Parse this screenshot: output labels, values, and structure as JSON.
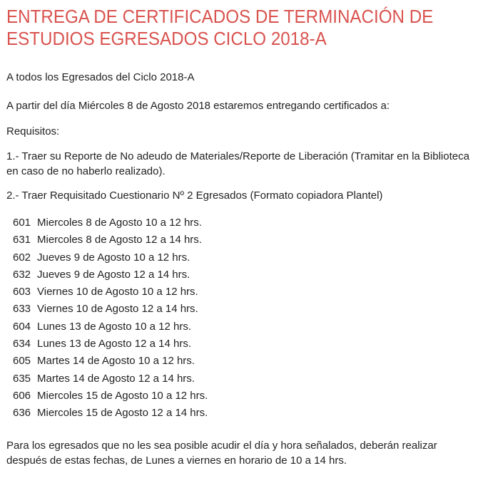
{
  "title": "ENTREGA DE CERTIFICADOS DE TERMINACIÓN DE ESTUDIOS EGRESADOS CICLO 2018-A",
  "greeting": "A todos los Egresados del Ciclo 2018-A",
  "intro": "A partir del día Miércoles 8 de Agosto 2018 estaremos entregando certificados a:",
  "requirements_label": "Requisitos:",
  "requirement_1": "1.- Traer su Reporte de No adeudo de Materiales/Reporte de Liberación (Tramitar en la Biblioteca en caso de no haberlo realizado).",
  "requirement_2": "2.- Traer Requisitado Cuestionario Nº 2 Egresados (Formato copiadora Plantel)",
  "schedule": [
    {
      "code": "601",
      "text": "Miercoles 8 de Agosto 10 a 12 hrs."
    },
    {
      "code": "631",
      "text": "Miercoles 8 de Agosto 12 a 14 hrs."
    },
    {
      "code": "602",
      "text": "Jueves 9 de Agosto 10 a 12 hrs."
    },
    {
      "code": "632",
      "text": "Jueves 9 de Agosto 12 a 14 hrs."
    },
    {
      "code": "603",
      "text": "Viernes 10 de Agosto 10 a 12 hrs."
    },
    {
      "code": "633",
      "text": "Viernes 10 de Agosto 12 a 14 hrs."
    },
    {
      "code": "604",
      "text": "Lunes 13 de Agosto 10 a 12 hrs."
    },
    {
      "code": "634",
      "text": "Lunes 13 de Agosto 12 a 14 hrs."
    },
    {
      "code": "605",
      "text": "Martes 14 de Agosto 10 a 12 hrs."
    },
    {
      "code": "635",
      "text": "Martes 14 de Agosto 12 a 14 hrs."
    },
    {
      "code": "606",
      "text": "Miercoles 15 de Agosto 10 a 12 hrs."
    },
    {
      "code": "636",
      "text": "Miercoles 15 de Agosto 12 a 14 hrs."
    }
  ],
  "closing": "Para los egresados que no les sea posible acudir el día y hora señalados, deberán realizar después de estas fechas, de Lunes a viernes en horario de 10 a 14 hrs.",
  "colors": {
    "title": "#d9534f",
    "text": "#222222"
  }
}
